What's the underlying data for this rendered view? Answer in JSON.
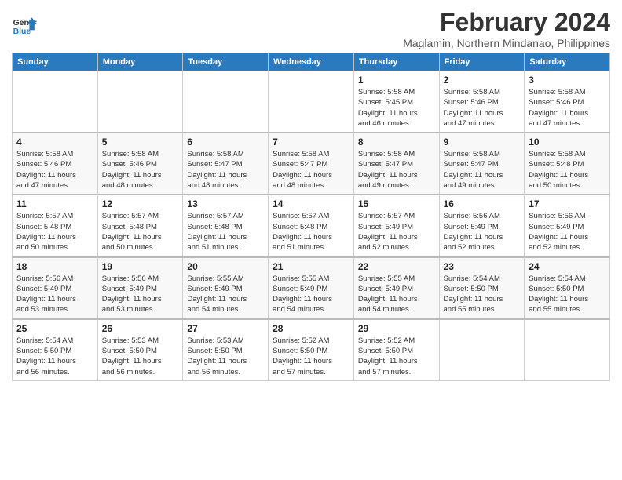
{
  "logo": {
    "text_general": "General",
    "text_blue": "Blue"
  },
  "title": "February 2024",
  "subtitle": "Maglamin, Northern Mindanao, Philippines",
  "days_of_week": [
    "Sunday",
    "Monday",
    "Tuesday",
    "Wednesday",
    "Thursday",
    "Friday",
    "Saturday"
  ],
  "weeks": [
    [
      {
        "day": "",
        "info": ""
      },
      {
        "day": "",
        "info": ""
      },
      {
        "day": "",
        "info": ""
      },
      {
        "day": "",
        "info": ""
      },
      {
        "day": "1",
        "info": "Sunrise: 5:58 AM\nSunset: 5:45 PM\nDaylight: 11 hours\nand 46 minutes."
      },
      {
        "day": "2",
        "info": "Sunrise: 5:58 AM\nSunset: 5:46 PM\nDaylight: 11 hours\nand 47 minutes."
      },
      {
        "day": "3",
        "info": "Sunrise: 5:58 AM\nSunset: 5:46 PM\nDaylight: 11 hours\nand 47 minutes."
      }
    ],
    [
      {
        "day": "4",
        "info": "Sunrise: 5:58 AM\nSunset: 5:46 PM\nDaylight: 11 hours\nand 47 minutes."
      },
      {
        "day": "5",
        "info": "Sunrise: 5:58 AM\nSunset: 5:46 PM\nDaylight: 11 hours\nand 48 minutes."
      },
      {
        "day": "6",
        "info": "Sunrise: 5:58 AM\nSunset: 5:47 PM\nDaylight: 11 hours\nand 48 minutes."
      },
      {
        "day": "7",
        "info": "Sunrise: 5:58 AM\nSunset: 5:47 PM\nDaylight: 11 hours\nand 48 minutes."
      },
      {
        "day": "8",
        "info": "Sunrise: 5:58 AM\nSunset: 5:47 PM\nDaylight: 11 hours\nand 49 minutes."
      },
      {
        "day": "9",
        "info": "Sunrise: 5:58 AM\nSunset: 5:47 PM\nDaylight: 11 hours\nand 49 minutes."
      },
      {
        "day": "10",
        "info": "Sunrise: 5:58 AM\nSunset: 5:48 PM\nDaylight: 11 hours\nand 50 minutes."
      }
    ],
    [
      {
        "day": "11",
        "info": "Sunrise: 5:57 AM\nSunset: 5:48 PM\nDaylight: 11 hours\nand 50 minutes."
      },
      {
        "day": "12",
        "info": "Sunrise: 5:57 AM\nSunset: 5:48 PM\nDaylight: 11 hours\nand 50 minutes."
      },
      {
        "day": "13",
        "info": "Sunrise: 5:57 AM\nSunset: 5:48 PM\nDaylight: 11 hours\nand 51 minutes."
      },
      {
        "day": "14",
        "info": "Sunrise: 5:57 AM\nSunset: 5:48 PM\nDaylight: 11 hours\nand 51 minutes."
      },
      {
        "day": "15",
        "info": "Sunrise: 5:57 AM\nSunset: 5:49 PM\nDaylight: 11 hours\nand 52 minutes."
      },
      {
        "day": "16",
        "info": "Sunrise: 5:56 AM\nSunset: 5:49 PM\nDaylight: 11 hours\nand 52 minutes."
      },
      {
        "day": "17",
        "info": "Sunrise: 5:56 AM\nSunset: 5:49 PM\nDaylight: 11 hours\nand 52 minutes."
      }
    ],
    [
      {
        "day": "18",
        "info": "Sunrise: 5:56 AM\nSunset: 5:49 PM\nDaylight: 11 hours\nand 53 minutes."
      },
      {
        "day": "19",
        "info": "Sunrise: 5:56 AM\nSunset: 5:49 PM\nDaylight: 11 hours\nand 53 minutes."
      },
      {
        "day": "20",
        "info": "Sunrise: 5:55 AM\nSunset: 5:49 PM\nDaylight: 11 hours\nand 54 minutes."
      },
      {
        "day": "21",
        "info": "Sunrise: 5:55 AM\nSunset: 5:49 PM\nDaylight: 11 hours\nand 54 minutes."
      },
      {
        "day": "22",
        "info": "Sunrise: 5:55 AM\nSunset: 5:49 PM\nDaylight: 11 hours\nand 54 minutes."
      },
      {
        "day": "23",
        "info": "Sunrise: 5:54 AM\nSunset: 5:50 PM\nDaylight: 11 hours\nand 55 minutes."
      },
      {
        "day": "24",
        "info": "Sunrise: 5:54 AM\nSunset: 5:50 PM\nDaylight: 11 hours\nand 55 minutes."
      }
    ],
    [
      {
        "day": "25",
        "info": "Sunrise: 5:54 AM\nSunset: 5:50 PM\nDaylight: 11 hours\nand 56 minutes."
      },
      {
        "day": "26",
        "info": "Sunrise: 5:53 AM\nSunset: 5:50 PM\nDaylight: 11 hours\nand 56 minutes."
      },
      {
        "day": "27",
        "info": "Sunrise: 5:53 AM\nSunset: 5:50 PM\nDaylight: 11 hours\nand 56 minutes."
      },
      {
        "day": "28",
        "info": "Sunrise: 5:52 AM\nSunset: 5:50 PM\nDaylight: 11 hours\nand 57 minutes."
      },
      {
        "day": "29",
        "info": "Sunrise: 5:52 AM\nSunset: 5:50 PM\nDaylight: 11 hours\nand 57 minutes."
      },
      {
        "day": "",
        "info": ""
      },
      {
        "day": "",
        "info": ""
      }
    ]
  ]
}
